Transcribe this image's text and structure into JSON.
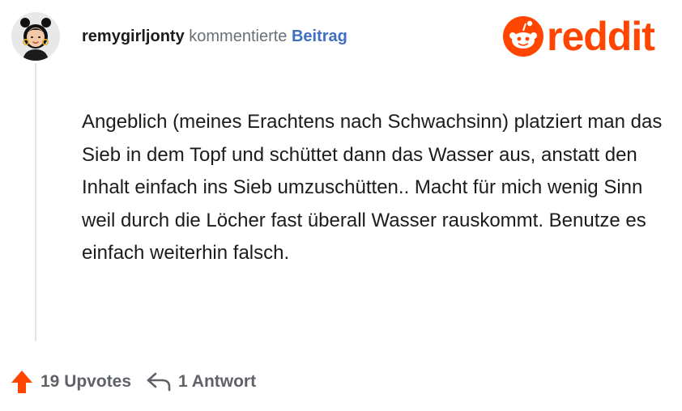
{
  "header": {
    "username": "remygirljonty",
    "action": "kommentierte",
    "post_link": "Beitrag"
  },
  "logo": {
    "wordmark": "reddit",
    "brand_color": "#ff4500"
  },
  "comment": {
    "text": "Angeblich (meines Erachtens nach Schwachsinn) platziert man das Sieb in dem Topf und schüttet dann das Wasser aus, anstatt den Inhalt einfach ins Sieb umzuschütten.. Macht für mich wenig Sinn weil durch die Löcher fast überall Wasser rauskommt. Benutze es einfach weiterhin falsch."
  },
  "footer": {
    "upvotes_label": "19 Upvotes",
    "replies_label": "1 Antwort",
    "upvote_color": "#ff4500"
  },
  "icons": [
    "avatar",
    "snoo-icon",
    "upvote-arrow-icon",
    "reply-arrow-icon"
  ]
}
